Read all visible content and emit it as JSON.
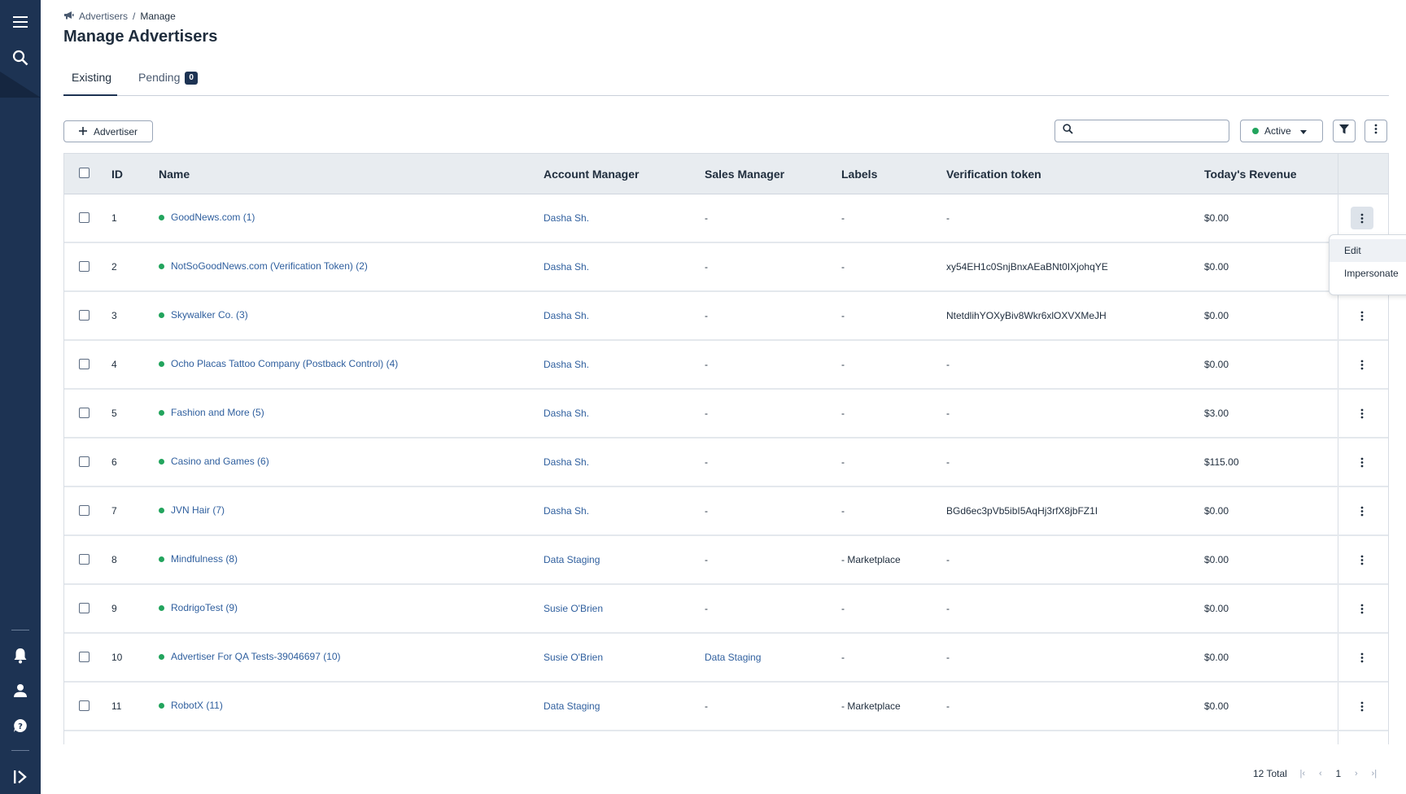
{
  "sidebar": {
    "icons": [
      "menu-icon",
      "search-icon",
      "bell-icon",
      "user-icon",
      "help-icon",
      "expand-icon"
    ]
  },
  "breadcrumb": {
    "section": "Advertisers",
    "separator": "/",
    "current": "Manage"
  },
  "page": {
    "title": "Manage Advertisers"
  },
  "tabs": [
    {
      "label": "Existing"
    },
    {
      "label": "Pending",
      "badge": "0"
    }
  ],
  "toolbar": {
    "add_label": "Advertiser",
    "search_placeholder": "",
    "status_filter": "Active"
  },
  "table": {
    "columns": [
      "ID",
      "Name",
      "Account Manager",
      "Sales Manager",
      "Labels",
      "Verification token",
      "Today's Revenue"
    ],
    "rows": [
      {
        "id": "1",
        "name": "GoodNews.com (1)",
        "account_manager": "Dasha Sh.",
        "sales_manager": "-",
        "labels": "-",
        "token": "-",
        "revenue": "$0.00"
      },
      {
        "id": "2",
        "name": "NotSoGoodNews.com (Verification Token) (2)",
        "account_manager": "Dasha Sh.",
        "sales_manager": "-",
        "labels": "-",
        "token": "xy54EH1c0SnjBnxAEaBNt0IXjohqYE",
        "revenue": "$0.00"
      },
      {
        "id": "3",
        "name": "Skywalker Co. (3)",
        "account_manager": "Dasha Sh.",
        "sales_manager": "-",
        "labels": "-",
        "token": "NtetdlihYOXyBiv8Wkr6xlOXVXMeJH",
        "revenue": "$0.00"
      },
      {
        "id": "4",
        "name": "Ocho Placas Tattoo Company (Postback Control) (4)",
        "account_manager": "Dasha Sh.",
        "sales_manager": "-",
        "labels": "-",
        "token": "-",
        "revenue": "$0.00"
      },
      {
        "id": "5",
        "name": "Fashion and More (5)",
        "account_manager": "Dasha Sh.",
        "sales_manager": "-",
        "labels": "-",
        "token": "-",
        "revenue": "$3.00"
      },
      {
        "id": "6",
        "name": "Casino and Games (6)",
        "account_manager": "Dasha Sh.",
        "sales_manager": "-",
        "labels": "-",
        "token": "-",
        "revenue": "$115.00"
      },
      {
        "id": "7",
        "name": "JVN Hair (7)",
        "account_manager": "Dasha Sh.",
        "sales_manager": "-",
        "labels": "-",
        "token": "BGd6ec3pVb5ibI5AqHj3rfX8jbFZ1I",
        "revenue": "$0.00"
      },
      {
        "id": "8",
        "name": "Mindfulness (8)",
        "account_manager": "Data Staging",
        "sales_manager": "-",
        "labels": "- Marketplace",
        "token": "-",
        "revenue": "$0.00"
      },
      {
        "id": "9",
        "name": "RodrigoTest (9)",
        "account_manager": "Susie O'Brien",
        "sales_manager": "-",
        "labels": "-",
        "token": "-",
        "revenue": "$0.00"
      },
      {
        "id": "10",
        "name": "Advertiser For QA Tests-39046697 (10)",
        "account_manager": "Susie O'Brien",
        "sales_manager": "Data Staging",
        "labels": "-",
        "token": "-",
        "revenue": "$0.00"
      },
      {
        "id": "11",
        "name": "RobotX (11)",
        "account_manager": "Data Staging",
        "sales_manager": "-",
        "labels": "- Marketplace",
        "token": "-",
        "revenue": "$0.00"
      }
    ]
  },
  "row_menu": {
    "items": [
      "Edit",
      "Impersonate"
    ]
  },
  "pagination": {
    "total": "12 Total",
    "current_page": "1"
  },
  "colors": {
    "sidebar": "#1d3353",
    "status_active": "#22a45d",
    "link": "#2f5f9e",
    "header_bg": "#e8ecf0"
  }
}
